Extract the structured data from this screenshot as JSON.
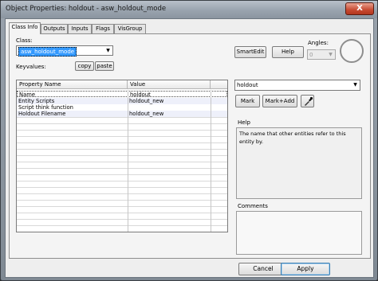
{
  "window": {
    "title": "Object Properties: holdout - asw_holdout_mode",
    "close_glyph": "X"
  },
  "tabs": [
    {
      "label": "Class Info",
      "active": true
    },
    {
      "label": "Outputs",
      "active": false
    },
    {
      "label": "Inputs",
      "active": false
    },
    {
      "label": "Flags",
      "active": false
    },
    {
      "label": "VisGroup",
      "active": false
    }
  ],
  "class_info": {
    "class_label": "Class:",
    "class_value": "asw_holdout_mode",
    "keyvalues_label": "Keyvalues:",
    "copy_label": "copy",
    "paste_label": "paste",
    "smartedit_label": "SmartEdit",
    "help_label": "Help",
    "angles_label": "Angles:",
    "angles_value": "0"
  },
  "grid": {
    "headers": [
      "Property Name",
      "Value"
    ],
    "rows": [
      {
        "name": "Name",
        "value": "holdout"
      },
      {
        "name": "Entity Scripts",
        "value": "holdout_new"
      },
      {
        "name": "Script think function",
        "value": ""
      },
      {
        "name": "Holdout Filename",
        "value": "holdout_new"
      }
    ]
  },
  "value_editor": {
    "value": "holdout",
    "mark_label": "Mark",
    "mark_add_label": "Mark+Add",
    "eyedropper_icon": "eyedropper-icon"
  },
  "help_panel": {
    "title": "Help",
    "text": "The name that other entities refer to this entity by."
  },
  "comments_panel": {
    "title": "Comments",
    "text": ""
  },
  "footer": {
    "cancel_label": "Cancel",
    "apply_label": "Apply"
  },
  "colors": {
    "selection": "#3399ff",
    "close_button": "#c74a32"
  }
}
